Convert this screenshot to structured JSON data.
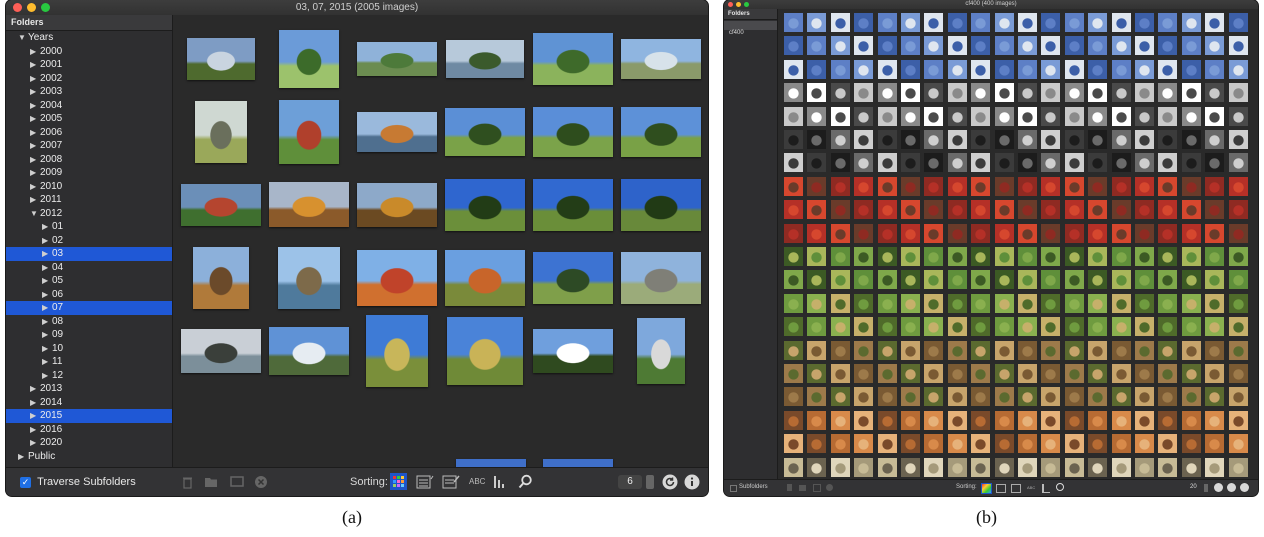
{
  "panel_a": {
    "window_title": "03, 07, 2015 (2005 images)",
    "sidebar_header": "Folders",
    "tree": [
      {
        "label": "Years",
        "level": 0,
        "open": true,
        "selected": false
      },
      {
        "label": "2000",
        "level": 1,
        "open": false,
        "selected": false
      },
      {
        "label": "2001",
        "level": 1,
        "open": false,
        "selected": false
      },
      {
        "label": "2002",
        "level": 1,
        "open": false,
        "selected": false
      },
      {
        "label": "2003",
        "level": 1,
        "open": false,
        "selected": false
      },
      {
        "label": "2004",
        "level": 1,
        "open": false,
        "selected": false
      },
      {
        "label": "2005",
        "level": 1,
        "open": false,
        "selected": false
      },
      {
        "label": "2006",
        "level": 1,
        "open": false,
        "selected": false
      },
      {
        "label": "2007",
        "level": 1,
        "open": false,
        "selected": false
      },
      {
        "label": "2008",
        "level": 1,
        "open": false,
        "selected": false
      },
      {
        "label": "2009",
        "level": 1,
        "open": false,
        "selected": false
      },
      {
        "label": "2010",
        "level": 1,
        "open": false,
        "selected": false
      },
      {
        "label": "2011",
        "level": 1,
        "open": false,
        "selected": false
      },
      {
        "label": "2012",
        "level": 1,
        "open": true,
        "selected": false
      },
      {
        "label": "01",
        "level": 2,
        "open": false,
        "selected": false
      },
      {
        "label": "02",
        "level": 2,
        "open": false,
        "selected": false
      },
      {
        "label": "03",
        "level": 2,
        "open": false,
        "selected": true
      },
      {
        "label": "04",
        "level": 2,
        "open": false,
        "selected": false
      },
      {
        "label": "05",
        "level": 2,
        "open": false,
        "selected": false
      },
      {
        "label": "06",
        "level": 2,
        "open": false,
        "selected": false
      },
      {
        "label": "07",
        "level": 2,
        "open": false,
        "selected": true
      },
      {
        "label": "08",
        "level": 2,
        "open": false,
        "selected": false
      },
      {
        "label": "09",
        "level": 2,
        "open": false,
        "selected": false
      },
      {
        "label": "10",
        "level": 2,
        "open": false,
        "selected": false
      },
      {
        "label": "11",
        "level": 2,
        "open": false,
        "selected": false
      },
      {
        "label": "12",
        "level": 2,
        "open": false,
        "selected": false
      },
      {
        "label": "2013",
        "level": 1,
        "open": false,
        "selected": false
      },
      {
        "label": "2014",
        "level": 1,
        "open": false,
        "selected": false
      },
      {
        "label": "2015",
        "level": 1,
        "open": false,
        "selected": true
      },
      {
        "label": "2016",
        "level": 1,
        "open": false,
        "selected": false
      },
      {
        "label": "2020",
        "level": 1,
        "open": false,
        "selected": false
      },
      {
        "label": "Public",
        "level": 0,
        "open": false,
        "selected": false
      }
    ],
    "traverse_label": "Traverse Subfolders",
    "sorting_label": "Sorting:",
    "sort_abc_label": "ABC",
    "columns_value": "6",
    "photos": [
      {
        "name": "cloudy-meadow",
        "colors": [
          "#7e9cc4",
          "#c9d4e0",
          "#4e6a2e"
        ]
      },
      {
        "name": "tall-tree-sky",
        "colors": [
          "#6b9bd8",
          "#3c6b2a",
          "#9cc26c"
        ]
      },
      {
        "name": "hillside-lake",
        "colors": [
          "#8fb2d9",
          "#4d7a3a",
          "#6b8c50"
        ]
      },
      {
        "name": "lakeside-trees",
        "colors": [
          "#b7c9da",
          "#3b5a2c",
          "#6f8aa3"
        ]
      },
      {
        "name": "park-tree",
        "colors": [
          "#5f93d4",
          "#3e6a2a",
          "#8bb35c"
        ]
      },
      {
        "name": "bay-view",
        "colors": [
          "#8fb5e0",
          "#d7e2ea",
          "#8a9a6a"
        ]
      },
      {
        "name": "bare-tree",
        "colors": [
          "#cfd8d2",
          "#6a6f5c",
          "#9aa85a"
        ]
      },
      {
        "name": "autumn-garden",
        "colors": [
          "#6d9fd8",
          "#b0402c",
          "#5f8f3a"
        ]
      },
      {
        "name": "lake-reflection",
        "colors": [
          "#9ab9dc",
          "#c77a33",
          "#4f6f8f"
        ]
      },
      {
        "name": "oak-tree-1",
        "colors": [
          "#5b8fd6",
          "#2f4f1f",
          "#7aa248"
        ]
      },
      {
        "name": "oak-tree-2",
        "colors": [
          "#5a8ed8",
          "#2e4d1d",
          "#7ba34a"
        ]
      },
      {
        "name": "oak-tree-3",
        "colors": [
          "#5d91d8",
          "#2f4e1e",
          "#79a146"
        ]
      },
      {
        "name": "red-garden-pond",
        "colors": [
          "#6b8fb8",
          "#b5452f",
          "#3f6f2f"
        ]
      },
      {
        "name": "autumn-yellow",
        "colors": [
          "#a8b6c9",
          "#d7912f",
          "#8b5a2a"
        ]
      },
      {
        "name": "autumn-hedge",
        "colors": [
          "#8da9c9",
          "#c98a2a",
          "#6b4a22"
        ]
      },
      {
        "name": "oak-blue-sky-1",
        "colors": [
          "#2f66cf",
          "#223c16",
          "#6b8f3a"
        ]
      },
      {
        "name": "oak-blue-sky-2",
        "colors": [
          "#3169d0",
          "#233d17",
          "#6a8e39"
        ]
      },
      {
        "name": "oak-blue-sky-3",
        "colors": [
          "#2e63ca",
          "#213a15",
          "#68893a"
        ]
      },
      {
        "name": "trunk-autumn",
        "colors": [
          "#8cb0da",
          "#6b4a2a",
          "#b07a3a"
        ]
      },
      {
        "name": "willow-branches",
        "colors": [
          "#9cc2e8",
          "#7d6a4a",
          "#4f7a9c"
        ]
      },
      {
        "name": "red-maple",
        "colors": [
          "#7fb0e6",
          "#c0432a",
          "#d0702f"
        ]
      },
      {
        "name": "orange-bush",
        "colors": [
          "#6a9fe0",
          "#c8652a",
          "#7a8a3a"
        ]
      },
      {
        "name": "pine-field",
        "colors": [
          "#3d73d2",
          "#2d4a25",
          "#7f9f4a"
        ]
      },
      {
        "name": "bare-winter-tree",
        "colors": [
          "#8fb3dc",
          "#7f7f77",
          "#9bab7a"
        ]
      },
      {
        "name": "sunset-tree",
        "colors": [
          "#c9cfd6",
          "#3a3f3a",
          "#7c8f9a"
        ]
      },
      {
        "name": "mountain-snow",
        "colors": [
          "#5f92d6",
          "#e6ecf2",
          "#4f6a3a"
        ]
      },
      {
        "name": "pampas-grass-1",
        "colors": [
          "#3e7bd6",
          "#c8b65a",
          "#7a8f3a"
        ]
      },
      {
        "name": "pampas-grass-2",
        "colors": [
          "#4a83d8",
          "#c9b357",
          "#6f8a37"
        ]
      },
      {
        "name": "lone-tree-clouds",
        "colors": [
          "#6f9fdd",
          "#ffffff",
          "#2f4a1f"
        ]
      },
      {
        "name": "tower-trees",
        "colors": [
          "#7ea8dc",
          "#d9d9d9",
          "#4e7a34"
        ]
      }
    ]
  },
  "panel_b": {
    "window_title": "cf400 (400 images)",
    "sidebar_header": "Folders",
    "folders": [
      "cf400"
    ],
    "subfolders_label": "Subfolders",
    "sorting_label": "Sorting:",
    "sort_abc_label": "ABC",
    "columns_value": "20"
  },
  "captions": {
    "a": "(a)",
    "b": "(b)"
  },
  "colors": {
    "selection": "#1f58d6",
    "accent": "#1f6fe5",
    "window_bg": "#2b2b2b"
  },
  "icons": [
    "trash-icon",
    "folder-icon",
    "display-icon",
    "close-circle-icon",
    "color-sort-icon",
    "calendar-sort-icon",
    "calendar-edit-sort-icon",
    "histogram-sort-icon",
    "search-icon",
    "refresh-icon",
    "info-icon",
    "filter-icon"
  ]
}
